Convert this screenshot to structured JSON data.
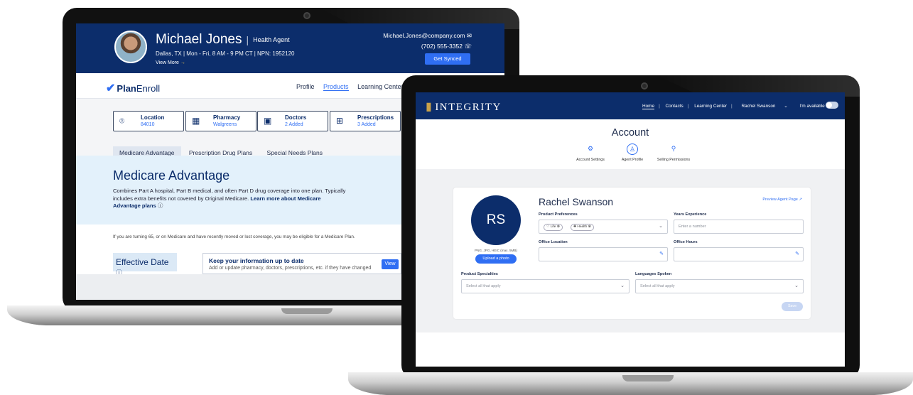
{
  "planenroll": {
    "agent": {
      "name": "Michael Jones",
      "role": "Health Agent",
      "meta": "Dallas, TX  |  Mon - Fri, 8 AM - 9 PM CT  |  NPN: 1952120",
      "view_more": "View More",
      "email": "Michael.Jones@company.com",
      "phone": "(702) 555-3352",
      "sync_label": "Get Synced"
    },
    "logo": {
      "bold": "Plan",
      "thin": "Enroll"
    },
    "nav": [
      "Profile",
      "Products",
      "Learning Center"
    ],
    "nav_active": "Products",
    "chips": [
      {
        "title": "Location",
        "value": "84010",
        "icon": "location-pin-icon"
      },
      {
        "title": "Pharmacy",
        "value": "Walgreens",
        "icon": "pharmacy-icon"
      },
      {
        "title": "Doctors",
        "value": "2 Added",
        "icon": "doctor-icon"
      },
      {
        "title": "Prescriptions",
        "value": "3 Added",
        "icon": "prescription-icon"
      }
    ],
    "tabs": [
      "Medicare Advantage",
      "Prescription Drug Plans",
      "Special Needs Plans"
    ],
    "hero": {
      "title": "Medicare Advantage",
      "body": "Combines Part A hospital, Part B medical, and often Part D drug coverage into one plan. Typically includes extra benefits not covered by Original Medicare. ",
      "link": "Learn more about Medicare Advantage plans"
    },
    "note": "If you are turning 65, or on Medicare and have recently moved or lost coverage, you may be eligible for a Medicare Plan.",
    "effective_date": "Effective Date",
    "keep": {
      "title": "Keep your information up to date",
      "body": "Add or update pharmacy, doctors, prescriptions, etc. if they have changed",
      "button": "View"
    }
  },
  "integrity": {
    "logo": "INTEGRITY",
    "nav": [
      "Home",
      "Contacts",
      "Learning Center",
      "Rachel Swanson",
      "I'm available"
    ],
    "title": "Account",
    "icons": [
      {
        "label": "Account Settings",
        "icon": "gear-icon"
      },
      {
        "label": "Agent Profile",
        "icon": "agent-badge-icon"
      },
      {
        "label": "Selling Permissions",
        "icon": "key-icon"
      }
    ],
    "profile": {
      "initials": "RS",
      "formats": "PNG, JPG, HEIC (max. 5MB)",
      "upload": "Upload a photo",
      "name": "Rachel Swanson",
      "preview": "Preview Agent Page",
      "product_preferences_label": "Product Preferences",
      "product_tags": [
        "Life",
        "Health"
      ],
      "years_label": "Years Experience",
      "years_placeholder": "Enter a number",
      "office_location_label": "Office Location",
      "office_hours_label": "Office Hours",
      "specialties_label": "Product Specialties",
      "specialties_placeholder": "Select all that apply",
      "languages_label": "Languages Spoken",
      "languages_placeholder": "Select all that apply",
      "save": "Save"
    }
  }
}
